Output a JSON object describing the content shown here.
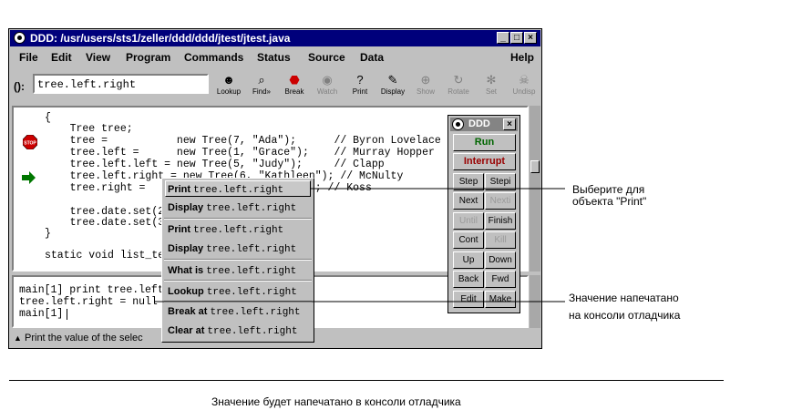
{
  "window": {
    "title": "DDD: /usr/users/sts1/zeller/ddd/ddd/jtest/jtest.java",
    "controls": [
      "minimize",
      "maximize",
      "close"
    ]
  },
  "menubar": {
    "items": [
      "File",
      "Edit",
      "View",
      "Program",
      "Commands",
      "Status",
      "Source",
      "Data"
    ],
    "help": "Help"
  },
  "toolbar": {
    "arg_label": "():",
    "arg_value": "tree.left.right",
    "buttons": [
      {
        "label": "Lookup",
        "icon": "lookup-icon",
        "enabled": true
      },
      {
        "label": "Find»",
        "icon": "find-icon",
        "enabled": true
      },
      {
        "label": "Break",
        "icon": "stop-icon",
        "enabled": true
      },
      {
        "label": "Watch",
        "icon": "watch-icon",
        "enabled": false
      },
      {
        "label": "Print",
        "icon": "print-icon",
        "enabled": true
      },
      {
        "label": "Display",
        "icon": "display-icon",
        "enabled": true
      },
      {
        "label": "Show",
        "icon": "show-icon",
        "enabled": false
      },
      {
        "label": "Rotate",
        "icon": "rotate-icon",
        "enabled": false
      },
      {
        "label": "Set",
        "icon": "set-icon",
        "enabled": false
      },
      {
        "label": "Undisp",
        "icon": "undisp-icon",
        "enabled": false
      }
    ]
  },
  "source": {
    "lines": [
      "{",
      "    Tree tree;",
      "    tree =           new Tree(7, \"Ada\");      // Byron Lovelace",
      "    tree.left =      new Tree(1, \"Grace\");    // Murray Hopper",
      "    tree.left.left = new Tree(5, \"Judy\");     // Clapp",
      "    tree.left.right = new Tree(6, \"Kathleen\"); // McNulty",
      "    tree.right =     new Tree(9, \"Mildred\"); // Koss",
      "",
      "    tree.date.set(2",
      "    tree.date.set(3",
      "}",
      "",
      "static void list_te"
    ]
  },
  "console": {
    "lines": [
      "main[1] print tree.left",
      "tree.left.right = null",
      "main[1] "
    ]
  },
  "status": {
    "text": "Print the value of the selec"
  },
  "popup": {
    "items": [
      {
        "cmd": "Print",
        "arg": "tree.left.right"
      },
      {
        "cmd": "Display",
        "arg": "tree.left.right"
      },
      {
        "cmd": "Print",
        "arg": "tree.left.right"
      },
      {
        "cmd": "Display",
        "arg": "tree.left.right"
      },
      {
        "cmd": "What is",
        "arg": "tree.left.right"
      },
      {
        "cmd": "Lookup",
        "arg": "tree.left.right"
      },
      {
        "cmd": "Break at",
        "arg": "tree.left.right"
      },
      {
        "cmd": "Clear at",
        "arg": "tree.left.right"
      }
    ]
  },
  "command_tool": {
    "title": "DDD",
    "run": "Run",
    "interrupt": "Interrupt",
    "buttons": [
      {
        "label": "Step",
        "enabled": true
      },
      {
        "label": "Stepi",
        "enabled": true
      },
      {
        "label": "Next",
        "enabled": true
      },
      {
        "label": "Nexti",
        "enabled": false
      },
      {
        "label": "Until",
        "enabled": false
      },
      {
        "label": "Finish",
        "enabled": true
      },
      {
        "label": "Cont",
        "enabled": true
      },
      {
        "label": "Kill",
        "enabled": false
      },
      {
        "label": "Up",
        "enabled": true
      },
      {
        "label": "Down",
        "enabled": true
      },
      {
        "label": "Back",
        "enabled": true
      },
      {
        "label": "Fwd",
        "enabled": true
      },
      {
        "label": "Edit",
        "enabled": true
      },
      {
        "label": "Make",
        "enabled": true
      }
    ]
  },
  "callouts": {
    "print": "Выберите для\nобъекта \"Print\"",
    "console": "Значение напечатано\nна консоли отладчика"
  },
  "caption": "Значение будет напечатано в консоли отладчика",
  "colors": {
    "titlebar": "#00007b",
    "run": "#006600",
    "interrupt": "#990000",
    "breakpoint": "#cc0000",
    "exec_arrow": "#007700"
  }
}
